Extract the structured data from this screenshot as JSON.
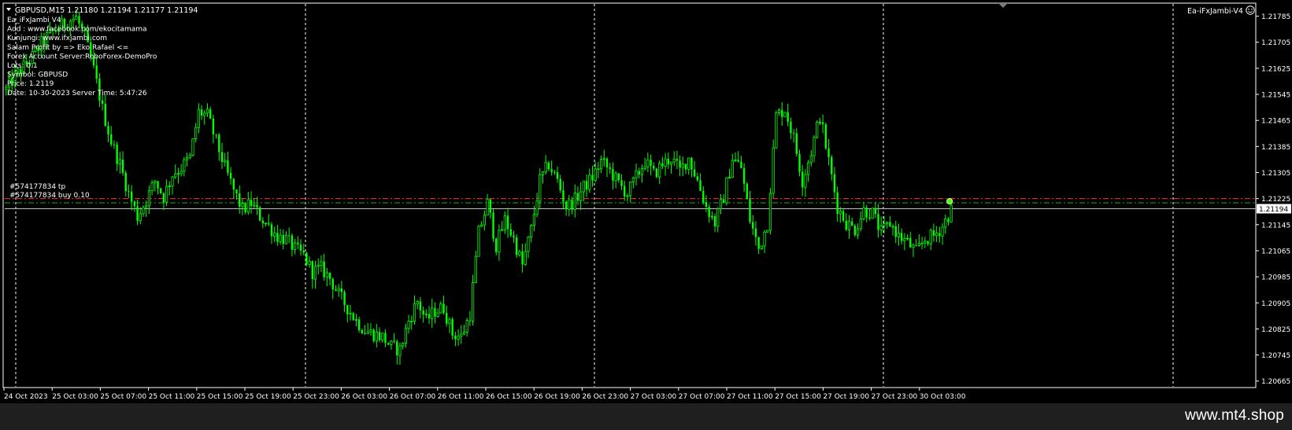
{
  "header": {
    "symbol_line": "GBPUSD,M15  1.21180 1.21194 1.21177 1.21194",
    "ea_badge": "Ea-iFxJambi-V4"
  },
  "info_panel": [
    "Ea_iFxJambi V4",
    "Add : www.facebook.com/ekocitamama",
    "Kunjungi: www.ifxjambi.com",
    "Salam Profit by =>  Eko Rafael <=",
    "Forex Account Server:RoboForex-DemoPro",
    "Lots:  0.1",
    "Symbol: GBPUSD",
    "Price:  1.2119",
    "Date: 10-30-2023 Server Time: 5:47:26"
  ],
  "orders": {
    "label_1": "#574177834 tp",
    "label_2": "#574177834 buy 0.10"
  },
  "watermark": "www.mt4.shop",
  "chart_data": {
    "type": "candlestick",
    "symbol": "GBPUSD",
    "timeframe": "M15",
    "ylim": [
      1.20645,
      1.21825
    ],
    "y_ticks": [
      "1.21785",
      "1.21705",
      "1.21625",
      "1.21545",
      "1.21465",
      "1.21385",
      "1.21305",
      "1.21225",
      "1.21145",
      "1.21065",
      "1.20985",
      "1.20905",
      "1.20825",
      "1.20745",
      "1.20665"
    ],
    "y_tick_values": [
      1.21785,
      1.21705,
      1.21625,
      1.21545,
      1.21465,
      1.21385,
      1.21305,
      1.21225,
      1.21145,
      1.21065,
      1.20985,
      1.20905,
      1.20825,
      1.20745,
      1.20665
    ],
    "x_ticks": [
      "24 Oct 2023",
      "25 Oct 03:00",
      "25 Oct 07:00",
      "25 Oct 11:00",
      "25 Oct 15:00",
      "25 Oct 19:00",
      "25 Oct 23:00",
      "26 Oct 03:00",
      "26 Oct 07:00",
      "26 Oct 11:00",
      "26 Oct 15:00",
      "26 Oct 19:00",
      "26 Oct 23:00",
      "27 Oct 03:00",
      "27 Oct 07:00",
      "27 Oct 11:00",
      "27 Oct 15:00",
      "27 Oct 19:00",
      "27 Oct 23:00",
      "30 Oct 03:00"
    ],
    "current_price": 1.21194,
    "current_price_label": "1.21194",
    "order_lines": [
      {
        "name": "tp",
        "price": 1.21225,
        "color": "#ff3333"
      },
      {
        "name": "buy",
        "price": 1.21212,
        "color": "#22aa22"
      }
    ],
    "colors": {
      "bull": "#00ff00",
      "bear": "#00ff00",
      "grid": "#ffffff",
      "axis": "#ffffff",
      "background": "#000000",
      "bid_line": "#c0c0c0"
    },
    "price_path": [
      [
        0,
        1.2156
      ],
      [
        3,
        1.216
      ],
      [
        6,
        1.2163
      ],
      [
        9,
        1.2166
      ],
      [
        12,
        1.217
      ],
      [
        15,
        1.2173
      ],
      [
        18,
        1.2175
      ],
      [
        21,
        1.2177
      ],
      [
        24,
        1.2178
      ],
      [
        27,
        1.2172
      ],
      [
        30,
        1.2162
      ],
      [
        33,
        1.215
      ],
      [
        36,
        1.214
      ],
      [
        39,
        1.2133
      ],
      [
        42,
        1.2124
      ],
      [
        45,
        1.2117
      ],
      [
        48,
        1.2122
      ],
      [
        51,
        1.2128
      ],
      [
        54,
        1.2123
      ],
      [
        57,
        1.213
      ],
      [
        60,
        1.2132
      ],
      [
        63,
        1.2135
      ],
      [
        66,
        1.2149
      ],
      [
        69,
        1.2148
      ],
      [
        72,
        1.214
      ],
      [
        75,
        1.2132
      ],
      [
        78,
        1.2125
      ],
      [
        81,
        1.2119
      ],
      [
        84,
        1.2121
      ],
      [
        87,
        1.2117
      ],
      [
        90,
        1.2114
      ],
      [
        93,
        1.2111
      ],
      [
        96,
        1.211
      ],
      [
        99,
        1.2107
      ],
      [
        102,
        1.2105
      ],
      [
        105,
        1.21
      ],
      [
        108,
        1.2101
      ],
      [
        111,
        1.2098
      ],
      [
        114,
        1.2093
      ],
      [
        117,
        1.2089
      ],
      [
        120,
        1.2085
      ],
      [
        123,
        1.2082
      ],
      [
        126,
        1.2081
      ],
      [
        129,
        1.208
      ],
      [
        132,
        1.2077
      ],
      [
        135,
        1.2076
      ],
      [
        138,
        1.2085
      ],
      [
        141,
        1.2091
      ],
      [
        144,
        1.2085
      ],
      [
        147,
        1.2088
      ],
      [
        150,
        1.2089
      ],
      [
        153,
        1.2081
      ],
      [
        156,
        1.208
      ],
      [
        159,
        1.2087
      ],
      [
        162,
        1.2112
      ],
      [
        165,
        1.2121
      ],
      [
        168,
        1.2108
      ],
      [
        171,
        1.2116
      ],
      [
        174,
        1.211
      ],
      [
        177,
        1.2102
      ],
      [
        180,
        1.2113
      ],
      [
        183,
        1.2128
      ],
      [
        186,
        1.2133
      ],
      [
        189,
        1.2128
      ],
      [
        192,
        1.212
      ],
      [
        195,
        1.2122
      ],
      [
        198,
        1.2126
      ],
      [
        201,
        1.2129
      ],
      [
        204,
        1.2134
      ],
      [
        207,
        1.2131
      ],
      [
        210,
        1.2127
      ],
      [
        213,
        1.2124
      ],
      [
        216,
        1.2129
      ],
      [
        219,
        1.2134
      ],
      [
        222,
        1.213
      ],
      [
        225,
        1.2133
      ],
      [
        228,
        1.2135
      ],
      [
        231,
        1.2131
      ],
      [
        234,
        1.2135
      ],
      [
        237,
        1.2128
      ],
      [
        240,
        1.212
      ],
      [
        243,
        1.2115
      ],
      [
        246,
        1.2123
      ],
      [
        249,
        1.2135
      ],
      [
        252,
        1.2132
      ],
      [
        255,
        1.2116
      ],
      [
        258,
        1.2107
      ],
      [
        261,
        1.2115
      ],
      [
        264,
        1.2148
      ],
      [
        267,
        1.215
      ],
      [
        270,
        1.2141
      ],
      [
        273,
        1.2128
      ],
      [
        276,
        1.2137
      ],
      [
        279,
        1.2148
      ],
      [
        282,
        1.2134
      ],
      [
        285,
        1.212
      ],
      [
        288,
        1.2115
      ],
      [
        291,
        1.2113
      ],
      [
        294,
        1.2119
      ],
      [
        297,
        1.2118
      ],
      [
        300,
        1.2112
      ],
      [
        303,
        1.2115
      ],
      [
        306,
        1.2111
      ],
      [
        309,
        1.2109
      ],
      [
        312,
        1.2106
      ],
      [
        315,
        1.211
      ],
      [
        318,
        1.2111
      ],
      [
        321,
        1.2114
      ],
      [
        324,
        1.2119
      ]
    ]
  }
}
